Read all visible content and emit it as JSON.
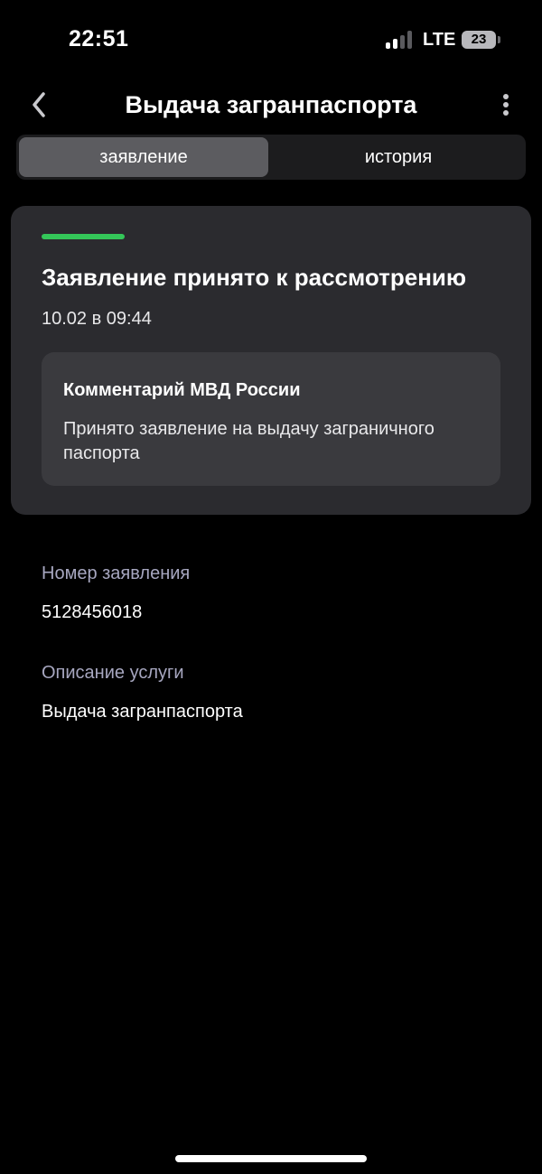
{
  "status_bar": {
    "time": "22:51",
    "network": "LTE",
    "battery": "23"
  },
  "nav": {
    "back_icon": "chevron-left-icon",
    "title": "Выдача загранпаспорта",
    "more_icon": "more-vertical-icon"
  },
  "tabs": [
    {
      "label": "заявление",
      "active": true
    },
    {
      "label": "история",
      "active": false
    }
  ],
  "status_card": {
    "accent_color": "#34c759",
    "title": "Заявление принято к рассмотрению",
    "date": "10.02 в 09:44",
    "comment": {
      "title": "Комментарий МВД России",
      "text": "Принято заявление на выдачу заграничного паспорта"
    }
  },
  "fields": [
    {
      "label": "Номер заявления",
      "value": "5128456018"
    },
    {
      "label": "Описание услуги",
      "value": "Выдача загранпаспорта"
    }
  ]
}
